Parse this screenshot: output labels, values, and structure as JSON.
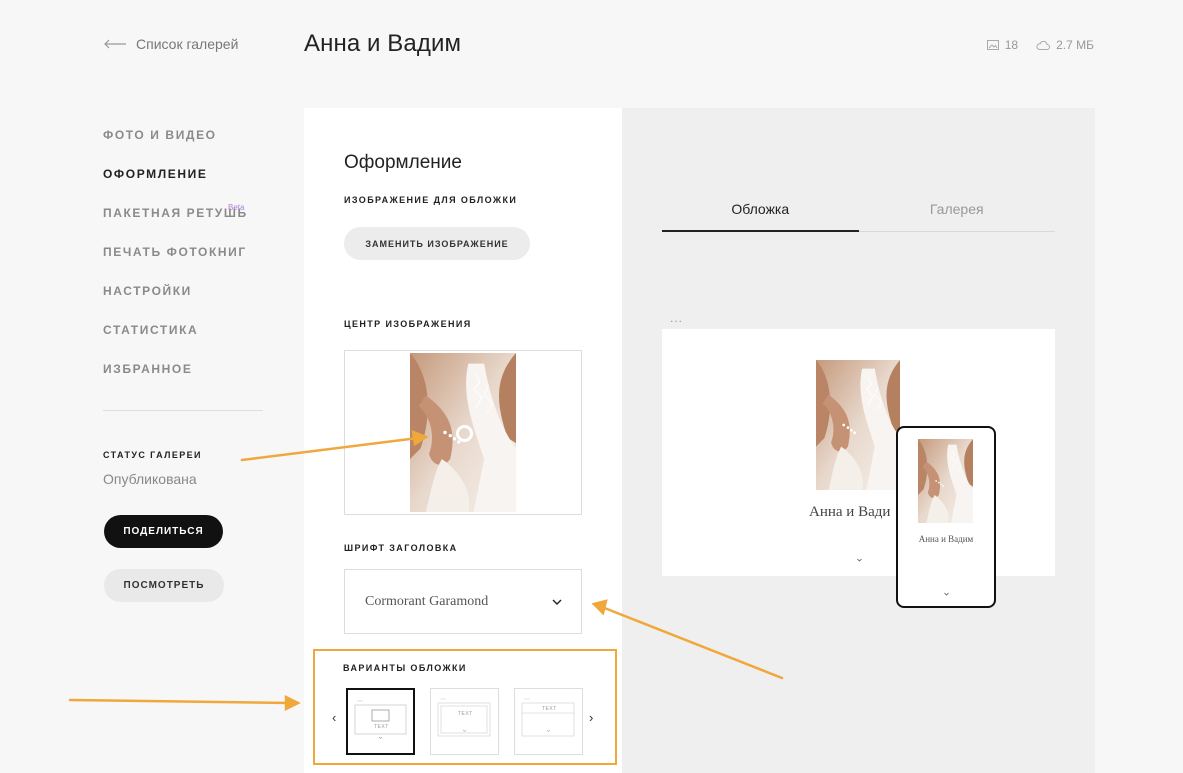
{
  "header": {
    "back_label": "Список галерей",
    "title": "Анна и Вадим",
    "photo_count": "18",
    "storage_size": "2.7 МБ"
  },
  "sidebar": {
    "items": [
      {
        "label": "ФОТО И ВИДЕО",
        "active": false
      },
      {
        "label": "ОФОРМЛЕНИЕ",
        "active": true
      },
      {
        "label": "ПАКЕТНАЯ РЕТУШЬ",
        "active": false,
        "badge": "Beta"
      },
      {
        "label": "ПЕЧАТЬ ФОТОКНИГ",
        "active": false
      },
      {
        "label": "НАСТРОЙКИ",
        "active": false
      },
      {
        "label": "СТАТИСТИКА",
        "active": false
      },
      {
        "label": "ИЗБРАННОЕ",
        "active": false
      }
    ],
    "status_label": "СТАТУС ГАЛЕРЕИ",
    "status_value": "Опубликована",
    "share_label": "ПОДЕЛИТЬСЯ",
    "view_label": "ПОСМОТРЕТЬ"
  },
  "design": {
    "title": "Оформление",
    "cover_image_label": "ИЗОБРАЖЕНИЕ ДЛЯ ОБЛОЖКИ",
    "replace_label": "ЗАМЕНИТЬ ИЗОБРАЖЕНИЕ",
    "focal_label": "ЦЕНТР ИЗОБРАЖЕНИЯ",
    "font_label": "ШРИФТ ЗАГОЛОВКА",
    "font_value": "Cormorant Garamond",
    "variants_label": "ВАРИАНТЫ ОБЛОЖКИ",
    "variant_text": "TEXT",
    "selected_variant": 0
  },
  "preview": {
    "tabs": [
      {
        "label": "Обложка",
        "active": true
      },
      {
        "label": "Галерея",
        "active": false
      }
    ],
    "menu_dots": "...",
    "cover_name": "Анна и Вадим",
    "cover_name_visible": "Анна и Вади"
  },
  "colors": {
    "accent_annotation": "#f0a73c",
    "beta_badge": "#b07fd0",
    "primary_button": "#111111"
  },
  "icons": [
    "arrow-left-icon",
    "image-icon",
    "cloud-icon",
    "chevron-down-icon",
    "chevron-left-icon",
    "chevron-right-icon",
    "more-dots-icon"
  ]
}
